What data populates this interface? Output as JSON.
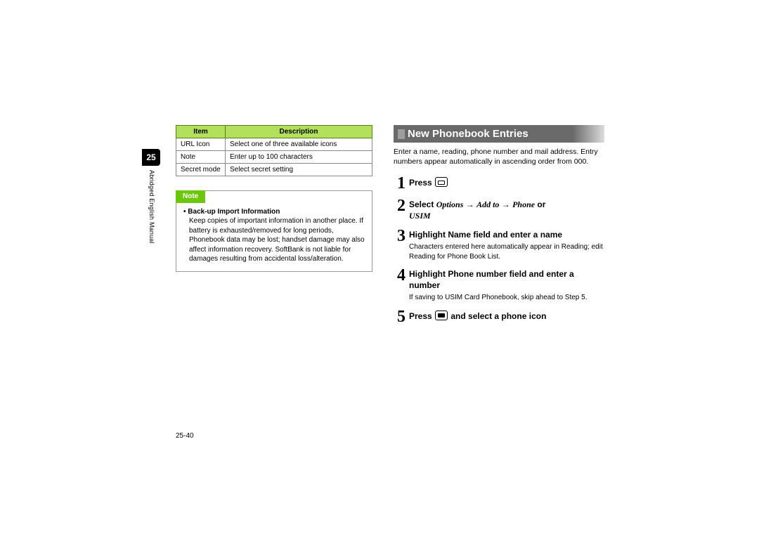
{
  "chapter_number": "25",
  "side_label": "Abridged English Manual",
  "table": {
    "headers": [
      "Item",
      "Description"
    ],
    "rows": [
      {
        "item": "URL Icon",
        "desc": "Select one of three available icons"
      },
      {
        "item": "Note",
        "desc": "Enter up to 100 characters"
      },
      {
        "item": "Secret mode",
        "desc": "Select secret setting"
      }
    ]
  },
  "note": {
    "label": "Note",
    "bullet_title": "Back-up Import Information",
    "body": "Keep copies of important information in another place. If battery is exhausted/removed for long periods, Phonebook data may be lost; handset damage may also affect information recovery. SoftBank is not liable for damages resulting from accidental loss/alteration."
  },
  "section_title": "New Phonebook Entries",
  "intro": "Enter a name, reading, phone number and mail address. Entry numbers appear automatically in ascending order from 000.",
  "steps": {
    "s1": {
      "pre": "Press "
    },
    "s2": {
      "pre": "Select ",
      "opt1": "Options",
      "mid1": " → ",
      "opt2": "Add to",
      "mid2": " → ",
      "opt3": "Phone",
      "or": " or ",
      "opt4": "USIM"
    },
    "s3": {
      "head": "Highlight Name field and enter a name",
      "sub": "Characters entered here automatically appear in Reading; edit Reading for Phone Book List."
    },
    "s4": {
      "head": "Highlight Phone number field and enter a number",
      "sub": "If saving to USIM Card Phonebook, skip ahead to Step 5."
    },
    "s5": {
      "pre": "Press ",
      "post": " and select a phone icon"
    }
  },
  "page_number": "25-40"
}
